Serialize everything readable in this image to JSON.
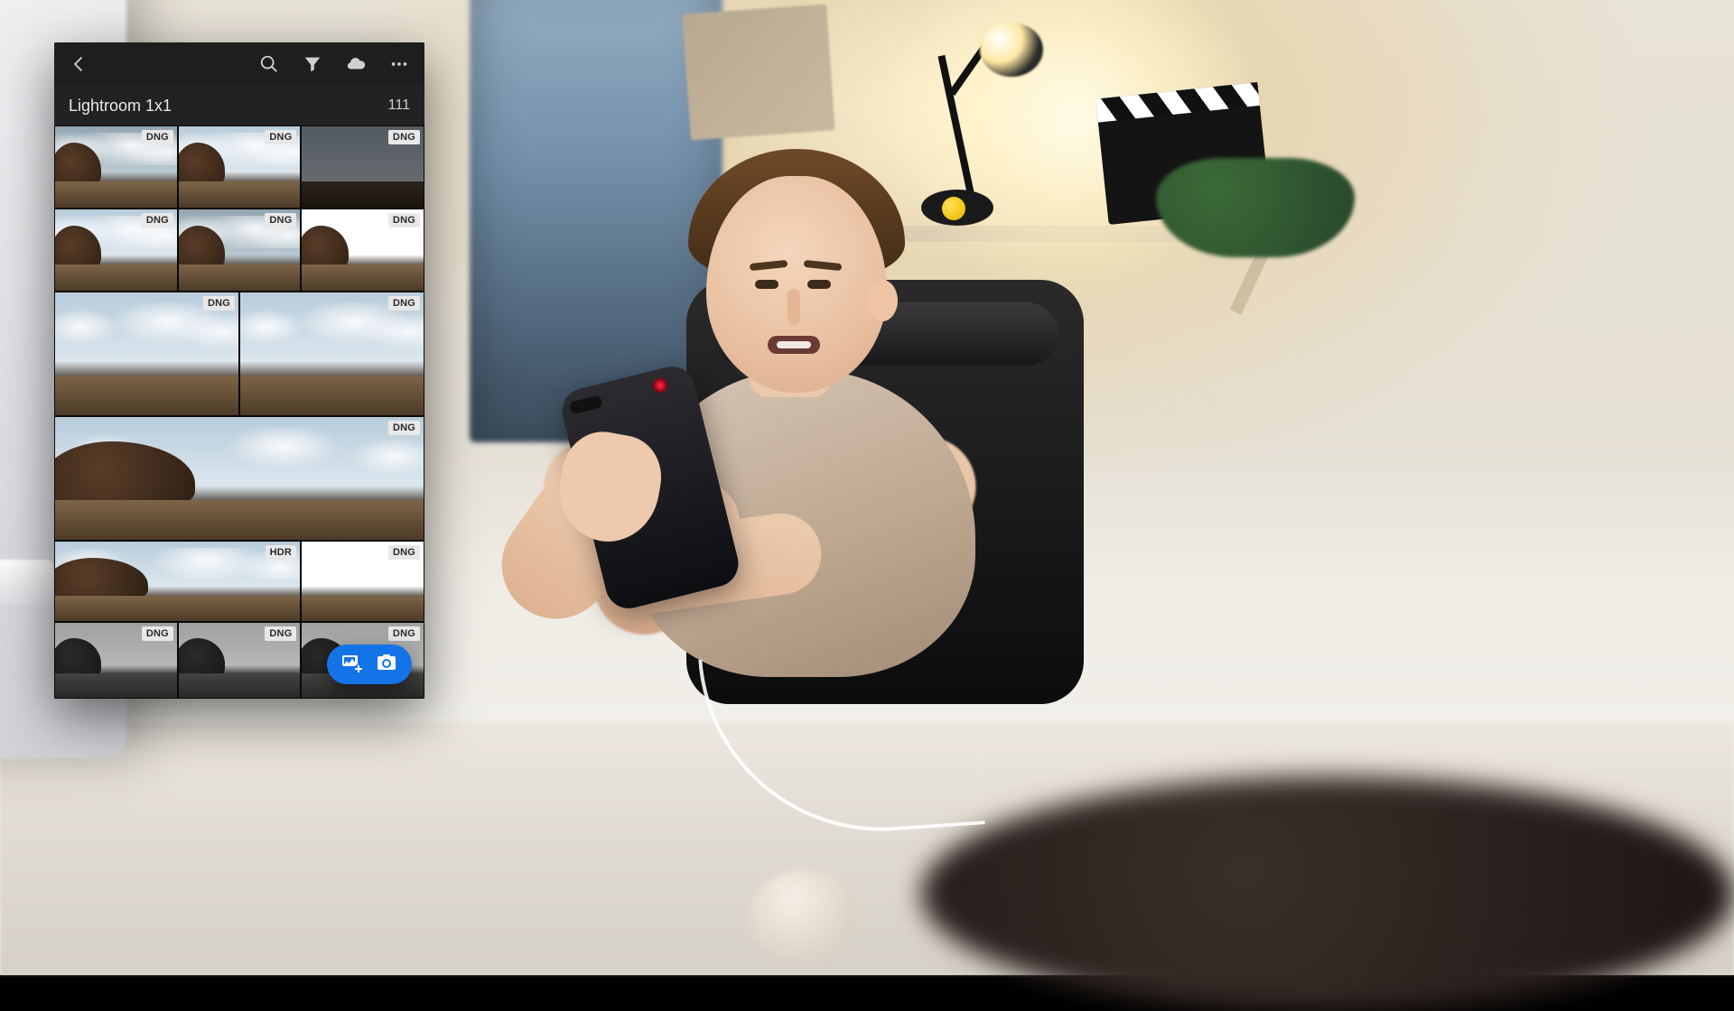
{
  "app": {
    "header": {
      "back_label": "Back",
      "search_label": "Search",
      "filter_label": "Filter",
      "cloud_label": "Cloud sync",
      "more_label": "More options"
    },
    "album": {
      "title": "Lightroom 1x1",
      "count": "111"
    },
    "badges": {
      "dng": "DNG",
      "hdr": "HDR"
    },
    "fab": {
      "import_label": "Import photos",
      "camera_label": "Open camera"
    },
    "colors": {
      "accent": "#1473e6",
      "bg": "#1c1c1c"
    }
  }
}
